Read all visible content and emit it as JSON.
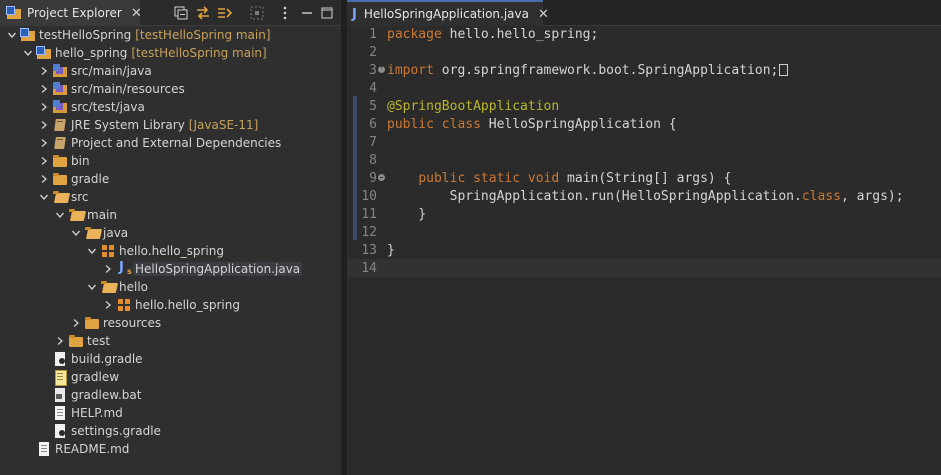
{
  "explorer": {
    "tab_label": "Project Explorer",
    "close_glyph": "✕",
    "toolbar": [
      "collapse-all-icon",
      "link-with-editor-icon",
      "filter-icon",
      "focus-icon",
      "view-menu-icon",
      "minimize-icon",
      "maximize-icon"
    ]
  },
  "tree": [
    {
      "indent": 0,
      "expand": "open",
      "icon": "project",
      "label": "testHelloSpring",
      "deco": "[testHelloSpring main]"
    },
    {
      "indent": 1,
      "expand": "open",
      "icon": "project",
      "label": "hello_spring",
      "deco": "[testHelloSpring main]"
    },
    {
      "indent": 2,
      "expand": "closed",
      "icon": "srcfolder",
      "label": "src/main/java",
      "deco": ""
    },
    {
      "indent": 2,
      "expand": "closed",
      "icon": "srcfolder",
      "label": "src/main/resources",
      "deco": ""
    },
    {
      "indent": 2,
      "expand": "closed",
      "icon": "srcfolder",
      "label": "src/test/java",
      "deco": ""
    },
    {
      "indent": 2,
      "expand": "closed",
      "icon": "book",
      "label": "JRE System Library",
      "deco": "[JavaSE-11]"
    },
    {
      "indent": 2,
      "expand": "closed",
      "icon": "book",
      "label": "Project and External Dependencies",
      "deco": ""
    },
    {
      "indent": 2,
      "expand": "closed",
      "icon": "folder",
      "label": "bin",
      "deco": ""
    },
    {
      "indent": 2,
      "expand": "closed",
      "icon": "folder",
      "label": "gradle",
      "deco": ""
    },
    {
      "indent": 2,
      "expand": "open",
      "icon": "folder open",
      "label": "src",
      "deco": ""
    },
    {
      "indent": 3,
      "expand": "open",
      "icon": "folder open",
      "label": "main",
      "deco": ""
    },
    {
      "indent": 4,
      "expand": "open",
      "icon": "folder open",
      "label": "java",
      "deco": ""
    },
    {
      "indent": 5,
      "expand": "open",
      "icon": "package",
      "label": "hello.hello_spring",
      "deco": ""
    },
    {
      "indent": 6,
      "expand": "closed",
      "icon": "javafile",
      "label": "HelloSpringApplication.java",
      "deco": "",
      "selected": true
    },
    {
      "indent": 5,
      "expand": "open",
      "icon": "folder open",
      "label": "hello",
      "deco": ""
    },
    {
      "indent": 6,
      "expand": "closed",
      "icon": "package",
      "label": "hello.hello_spring",
      "deco": ""
    },
    {
      "indent": 4,
      "expand": "closed",
      "icon": "folder",
      "label": "resources",
      "deco": ""
    },
    {
      "indent": 3,
      "expand": "closed",
      "icon": "folder",
      "label": "test",
      "deco": ""
    },
    {
      "indent": 2,
      "expand": "none",
      "icon": "gradlefile",
      "label": "build.gradle",
      "deco": ""
    },
    {
      "indent": 2,
      "expand": "none",
      "icon": "shfile",
      "label": "gradlew",
      "deco": ""
    },
    {
      "indent": 2,
      "expand": "none",
      "icon": "batfile",
      "label": "gradlew.bat",
      "deco": ""
    },
    {
      "indent": 2,
      "expand": "none",
      "icon": "textfile",
      "label": "HELP.md",
      "deco": ""
    },
    {
      "indent": 2,
      "expand": "none",
      "icon": "gradlefile",
      "label": "settings.gradle",
      "deco": ""
    },
    {
      "indent": 1,
      "expand": "none",
      "icon": "textfile",
      "label": "README.md",
      "deco": ""
    }
  ],
  "editor": {
    "tab_label": "HelloSpringApplication.java",
    "tab_icon": "J",
    "close_glyph": "✕",
    "current_line": 14,
    "lines": [
      {
        "n": "1",
        "fold": "",
        "segs": [
          [
            "kw",
            "package"
          ],
          [
            "t",
            " hello.hello_spring;"
          ]
        ]
      },
      {
        "n": "2",
        "fold": "",
        "segs": []
      },
      {
        "n": "3",
        "fold": "plus",
        "segs": [
          [
            "kw",
            "import"
          ],
          [
            "t",
            " org.springframework.boot.SpringApplication;"
          ],
          [
            "box",
            ""
          ]
        ]
      },
      {
        "n": "4",
        "fold": "",
        "segs": []
      },
      {
        "n": "5",
        "fold": "",
        "segs": [
          [
            "ann",
            "@SpringBootApplication"
          ]
        ]
      },
      {
        "n": "6",
        "fold": "",
        "segs": [
          [
            "kw",
            "public"
          ],
          [
            "t",
            " "
          ],
          [
            "kw",
            "class"
          ],
          [
            "t",
            " HelloSpringApplication {"
          ]
        ]
      },
      {
        "n": "7",
        "fold": "",
        "segs": []
      },
      {
        "n": "8",
        "fold": "",
        "segs": []
      },
      {
        "n": "9",
        "fold": "minus",
        "segs": [
          [
            "t",
            "    "
          ],
          [
            "kw",
            "public"
          ],
          [
            "t",
            " "
          ],
          [
            "kw",
            "static"
          ],
          [
            "t",
            " "
          ],
          [
            "kw",
            "void"
          ],
          [
            "t",
            " main(String[] args) {"
          ]
        ]
      },
      {
        "n": "10",
        "fold": "",
        "segs": [
          [
            "t",
            "        SpringApplication.run(HelloSpringApplication."
          ],
          [
            "kw",
            "class"
          ],
          [
            "t",
            ", args);"
          ]
        ]
      },
      {
        "n": "11",
        "fold": "",
        "segs": [
          [
            "t",
            "    }"
          ]
        ]
      },
      {
        "n": "12",
        "fold": "",
        "segs": []
      },
      {
        "n": "13",
        "fold": "",
        "segs": [
          [
            "t",
            "}"
          ]
        ]
      },
      {
        "n": "14",
        "fold": "",
        "segs": []
      }
    ]
  }
}
